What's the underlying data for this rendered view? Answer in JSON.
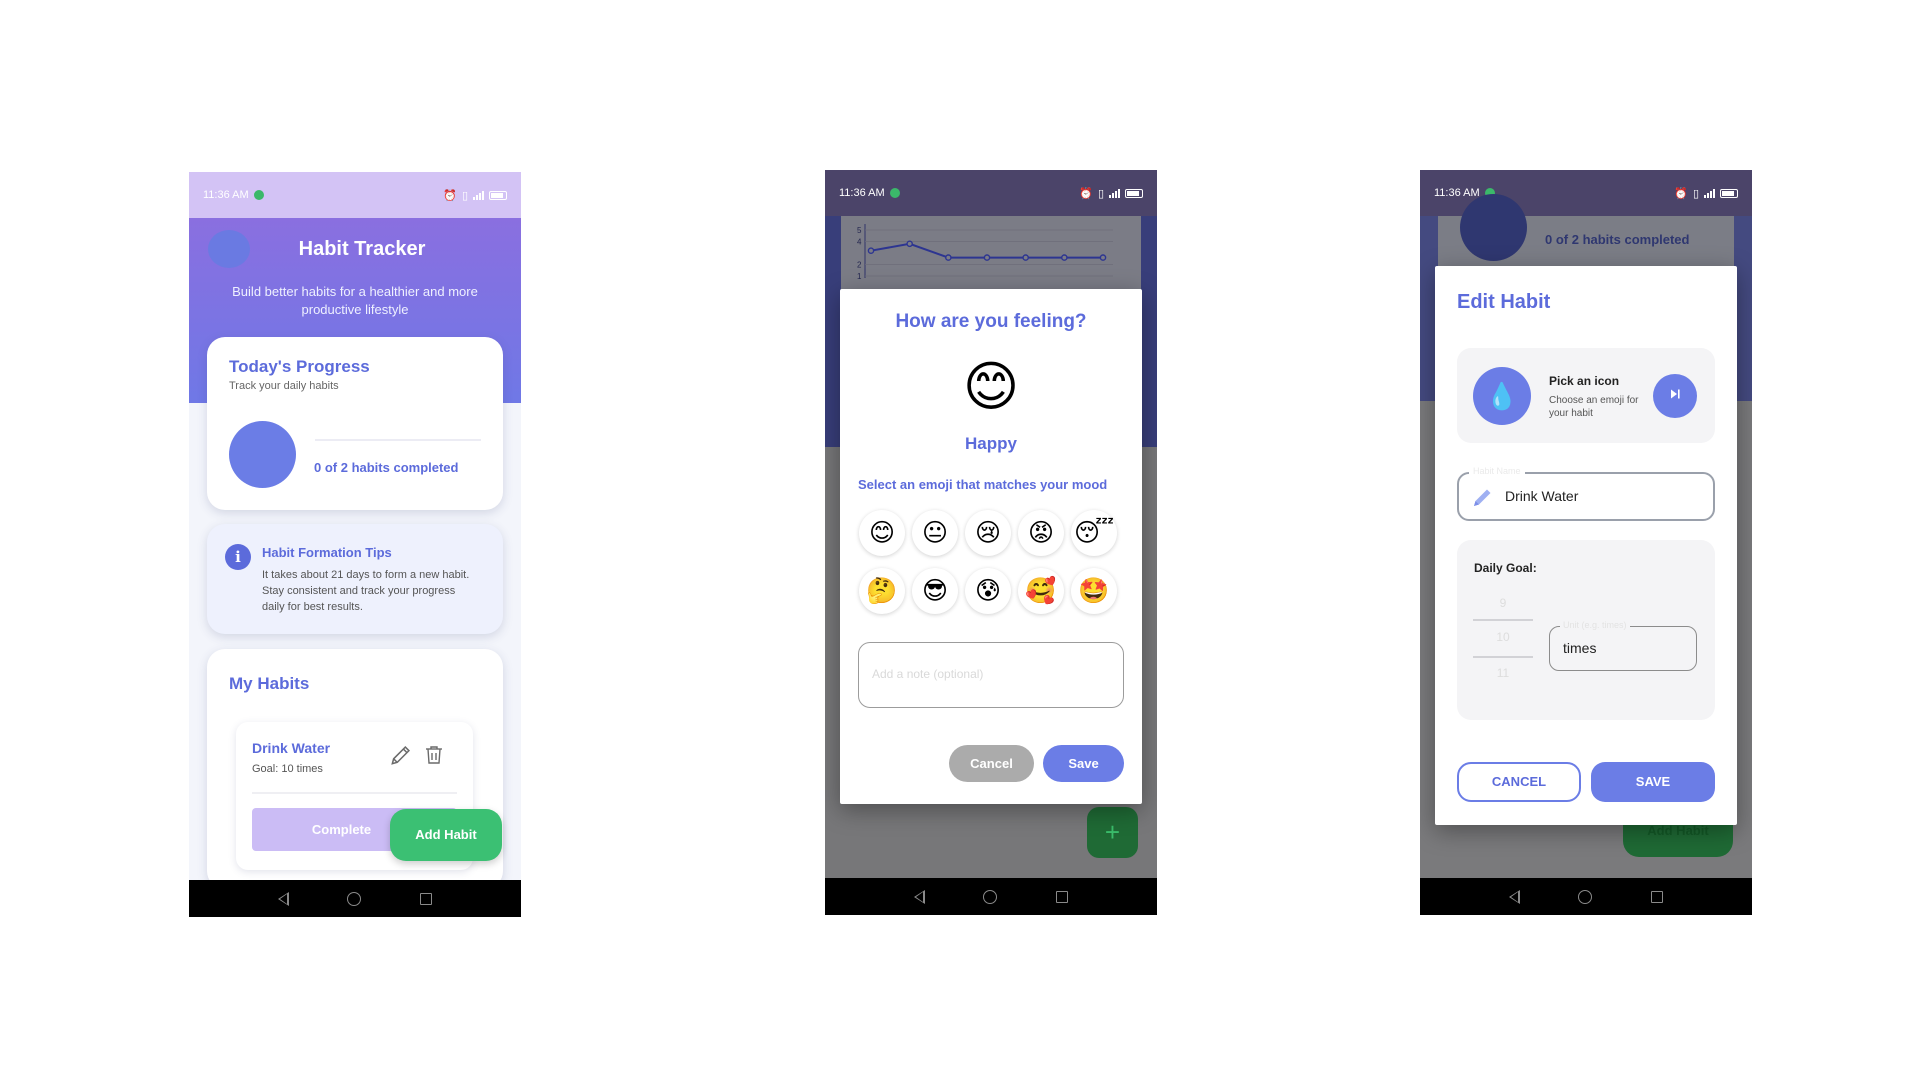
{
  "status_bar": {
    "time": "11:36 AM"
  },
  "screen1": {
    "header": {
      "title": "Habit Tracker",
      "subtitle": "Build better habits for a healthier and more productive lifestyle"
    },
    "progress": {
      "title": "Today's Progress",
      "subtitle": "Track your daily habits",
      "completed_text": "0 of 2 habits completed",
      "completed": 0,
      "total": 2
    },
    "tips": {
      "title": "Habit Formation Tips",
      "body": "It takes about 21 days to form a new habit. Stay consistent and track your progress daily for best results."
    },
    "habits": {
      "title": "My Habits",
      "items": [
        {
          "name": "Drink Water",
          "goal": "Goal: 10 times",
          "complete_label": "Complete"
        }
      ]
    },
    "fab_label": "Add Habit"
  },
  "screen2": {
    "background_chart": {
      "y_ticks": [
        "5",
        "4",
        "2",
        "1"
      ]
    },
    "chart_data": {
      "type": "line",
      "y_ticks": [
        5,
        4,
        2,
        1
      ],
      "series": [
        {
          "values": [
            3.2,
            3.8,
            2.6,
            2.6,
            2.6,
            2.6,
            2.6
          ]
        }
      ]
    },
    "dialog": {
      "title": "How are you feeling?",
      "selected_emoji": "😊",
      "selected_label": "Happy",
      "hint": "Select an emoji that matches your mood",
      "emojis": [
        "😊",
        "😐",
        "😢",
        "😡",
        "😴",
        "🤔",
        "😎",
        "😰",
        "🥰",
        "🤩"
      ],
      "note_placeholder": "Add a note (optional)",
      "cancel_label": "Cancel",
      "save_label": "Save"
    },
    "fab_symbol": "+"
  },
  "screen3": {
    "background": {
      "completed_text": "0 of 2 habits completed",
      "fab_label": "Add Habit"
    },
    "dialog": {
      "title": "Edit Habit",
      "icon_picker": {
        "icon": "💧",
        "title": "Pick an icon",
        "subtitle": "Choose an emoji for your habit"
      },
      "name_field": {
        "label": "Habit Name",
        "value": "Drink Water"
      },
      "goal": {
        "label": "Daily Goal:",
        "picker_values": [
          "9",
          "10",
          "11"
        ],
        "selected": 10,
        "unit_label": "Unit (e.g. times)",
        "unit_value": "times"
      },
      "cancel_label": "CANCEL",
      "save_label": "SAVE"
    }
  },
  "colors": {
    "accent": "#6b7de6",
    "title_blue": "#5c6bdb",
    "green": "#3bc073",
    "lavender": "#cbbcf5"
  }
}
